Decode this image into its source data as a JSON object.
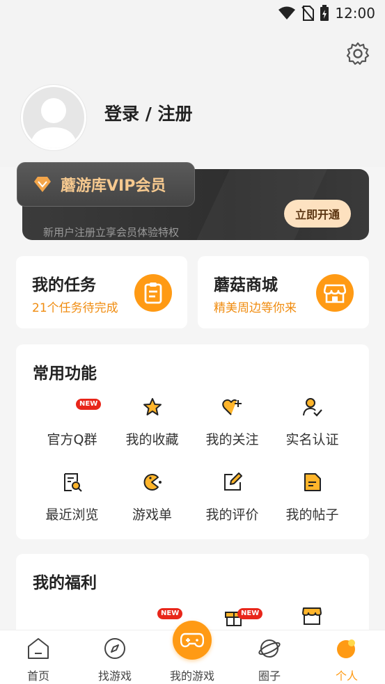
{
  "status_bar": {
    "time": "12:00"
  },
  "profile": {
    "login_label": "登录 / 注册"
  },
  "vip": {
    "title": "蘑游库VIP会员",
    "subtitle": "新用户注册立享会员体验特权",
    "button": "立即开通"
  },
  "cards": {
    "tasks": {
      "title": "我的任务",
      "subtitle": "21个任务待完成"
    },
    "store": {
      "title": "蘑菇商城",
      "subtitle": "精美周边等你来"
    }
  },
  "common": {
    "title": "常用功能",
    "items": [
      {
        "label": "官方Q群",
        "icon": "qq-group-icon",
        "badge": "NEW"
      },
      {
        "label": "我的收藏",
        "icon": "star-icon"
      },
      {
        "label": "我的关注",
        "icon": "follow-heart-icon"
      },
      {
        "label": "实名认证",
        "icon": "verify-user-icon"
      },
      {
        "label": "最近浏览",
        "icon": "history-search-icon"
      },
      {
        "label": "游戏单",
        "icon": "game-list-icon"
      },
      {
        "label": "我的评价",
        "icon": "edit-review-icon"
      },
      {
        "label": "我的帖子",
        "icon": "post-icon"
      }
    ]
  },
  "welfare": {
    "title": "我的福利",
    "badges": [
      "NEW",
      "NEW"
    ]
  },
  "nav": {
    "items": [
      "首页",
      "找游戏",
      "我的游戏",
      "圈子",
      "个人"
    ],
    "active_color": "#ff9a14"
  },
  "colors": {
    "accent": "#ff9a14",
    "accent_text": "#f08c10"
  }
}
